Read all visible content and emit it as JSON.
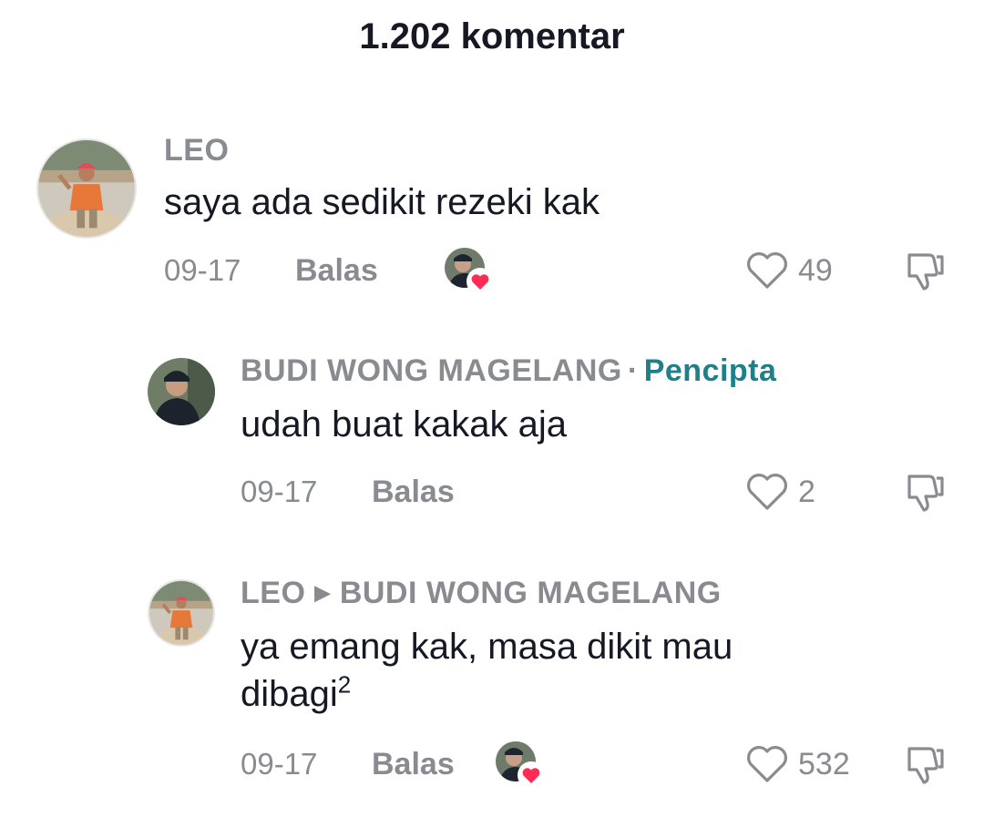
{
  "header": {
    "title": "1.202 komentar"
  },
  "comments": [
    {
      "username": "LEO",
      "text": "saya ada sedikit rezeki kak",
      "date": "09-17",
      "reply_label": "Balas",
      "liked_by_creator": true,
      "like_count": "49"
    },
    {
      "username": "BUDI WONG MAGELANG",
      "separator": "·",
      "creator_label": "Pencipta",
      "text": "udah buat kakak aja",
      "date": "09-17",
      "reply_label": "Balas",
      "liked_by_creator": false,
      "like_count": "2"
    },
    {
      "username": "LEO",
      "reply_to": "BUDI WONG MAGELANG",
      "text_line1": "ya emang kak, masa dikit mau",
      "text_line2": "dibagi",
      "text_sup": "2",
      "date": "09-17",
      "reply_label": "Balas",
      "liked_by_creator": true,
      "like_count": "532"
    }
  ],
  "icons": {
    "like": "heart-outline-icon",
    "dislike": "thumbs-down-icon",
    "reply_arrow": "triangle-right-icon",
    "creator_heart": "heart-filled-icon"
  },
  "colors": {
    "text": "#161823",
    "muted": "#8a8b91",
    "creator": "#20808a",
    "heart": "#fe2c55"
  }
}
